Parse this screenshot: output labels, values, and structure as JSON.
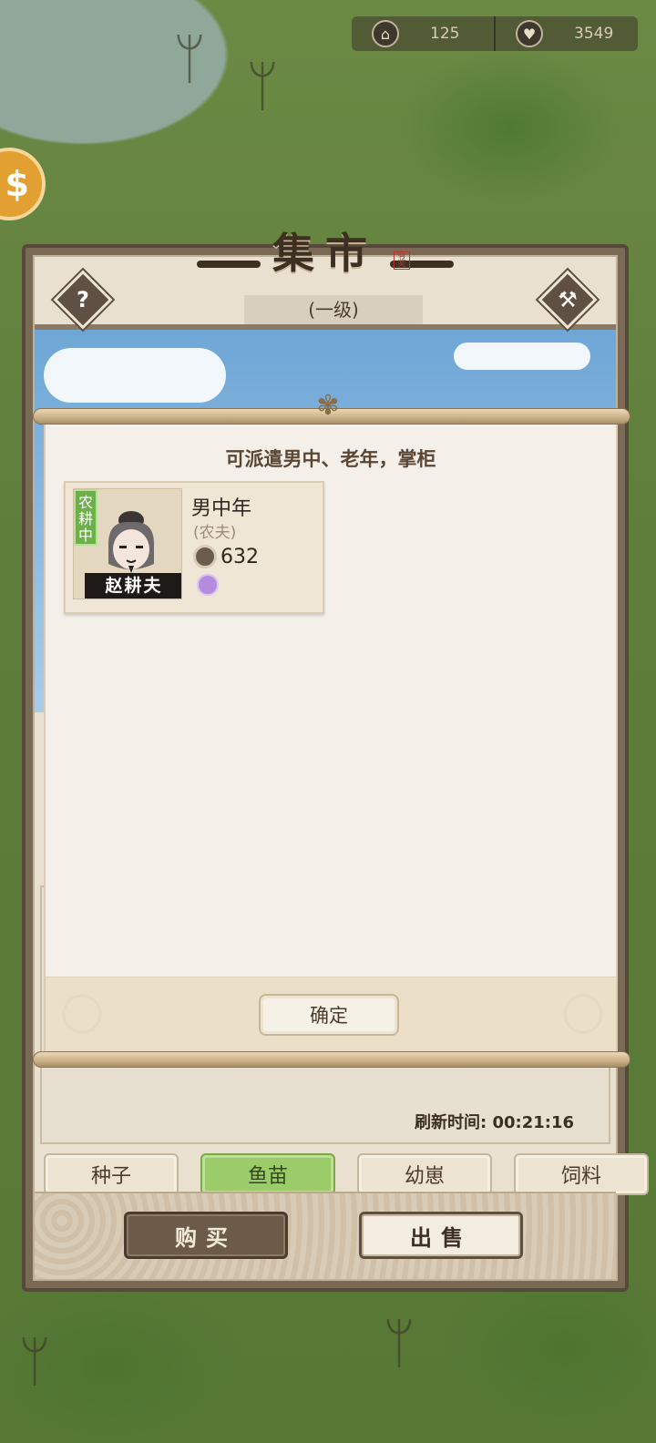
{
  "resources": {
    "house": {
      "icon": "house-icon",
      "value": "125"
    },
    "heart": {
      "icon": "heart-icon",
      "value": "3549"
    }
  },
  "market": {
    "title": "集市",
    "seal": "有奖",
    "level": "(一级)",
    "help_icon": "help-icon",
    "build_icon": "hammer-icon",
    "refresh_label": "刷新时间:",
    "refresh_time": "00:21:16",
    "tabs": [
      {
        "label": "种子",
        "active": false
      },
      {
        "label": "鱼苗",
        "active": true
      },
      {
        "label": "幼崽",
        "active": false
      },
      {
        "label": "饲料",
        "active": false
      }
    ],
    "buy_label": "购买",
    "sell_label": "出售"
  },
  "modal": {
    "heading": "可派遣男中、老年，掌柜",
    "character": {
      "status": "农耕中",
      "name": "赵耕夫",
      "type": "男中年",
      "job": "(农夫)",
      "power": "632"
    },
    "confirm_label": "确定"
  },
  "colors": {
    "active_tab": "#9ccb6a",
    "status_tag": "#6cb04a",
    "frame": "#56483a"
  }
}
